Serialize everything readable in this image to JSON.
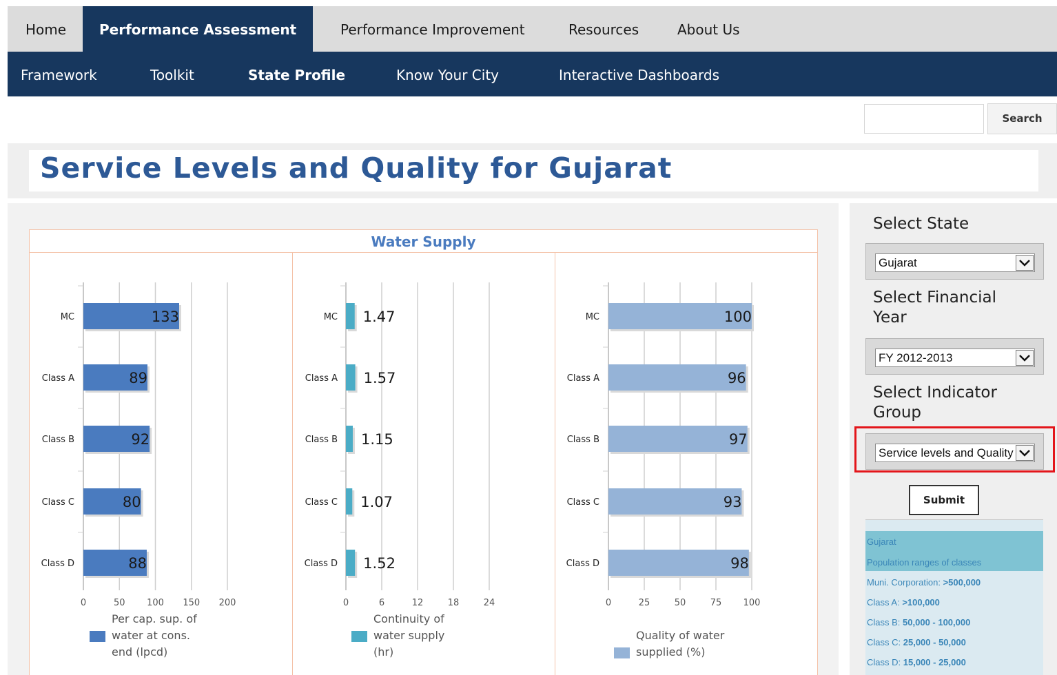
{
  "nav": {
    "primary": [
      {
        "label": "Home",
        "active": false
      },
      {
        "label": "Performance Assessment",
        "active": true
      },
      {
        "label": "Performance Improvement",
        "active": false
      },
      {
        "label": "Resources",
        "active": false
      },
      {
        "label": "About Us",
        "active": false
      }
    ],
    "secondary": [
      {
        "label": "Framework",
        "active": false
      },
      {
        "label": "Toolkit",
        "active": false
      },
      {
        "label": "State Profile",
        "active": true
      },
      {
        "label": "Know Your City",
        "active": false
      },
      {
        "label": "Interactive Dashboards",
        "active": false
      }
    ]
  },
  "search": {
    "value": "",
    "button_label": "Search"
  },
  "page": {
    "title": "Service Levels and Quality for Gujarat"
  },
  "chart_section": {
    "title": "Water Supply"
  },
  "chart_data": [
    {
      "type": "bar",
      "orientation": "horizontal",
      "categories": [
        "MC",
        "Class A",
        "Class B",
        "Class C",
        "Class D"
      ],
      "values": [
        133,
        89,
        92,
        80,
        88
      ],
      "value_labels": [
        "133",
        "89",
        "92",
        "80",
        "88"
      ],
      "xlim": [
        0,
        200
      ],
      "xticks": [
        0,
        50,
        100,
        150,
        200
      ],
      "grid": true,
      "legend": {
        "label": "Per cap. sup. of water at cons. end (lpcd)",
        "lines": [
          "Per cap. sup. of",
          "water at cons.",
          "end (lpcd)"
        ],
        "placement": "bottom"
      },
      "color": "#4a7bbf"
    },
    {
      "type": "bar",
      "orientation": "horizontal",
      "categories": [
        "MC",
        "Class A",
        "Class B",
        "Class C",
        "Class D"
      ],
      "values": [
        1.47,
        1.57,
        1.15,
        1.07,
        1.52
      ],
      "value_labels": [
        "1.47",
        "1.57",
        "1.15",
        "1.07",
        "1.52"
      ],
      "xlim": [
        0,
        24
      ],
      "xticks": [
        0,
        6,
        12,
        18,
        24
      ],
      "grid": true,
      "legend": {
        "label": "Continuity of water supply (hr)",
        "lines": [
          "Continuity of",
          "water supply",
          "(hr)"
        ],
        "placement": "bottom"
      },
      "color": "#4bacc6"
    },
    {
      "type": "bar",
      "orientation": "horizontal",
      "categories": [
        "MC",
        "Class A",
        "Class B",
        "Class C",
        "Class D"
      ],
      "values": [
        100,
        96,
        97,
        93,
        98
      ],
      "value_labels": [
        "100",
        "96",
        "97",
        "93",
        "98"
      ],
      "xlim": [
        0,
        100
      ],
      "xticks": [
        0,
        25,
        50,
        75,
        100
      ],
      "grid": true,
      "legend": {
        "label": "Quality of water supplied (%)",
        "lines": [
          "Quality of water",
          "supplied (%)"
        ],
        "placement": "bottom"
      },
      "color": "#95b3d7"
    }
  ],
  "sidebar": {
    "state_label": "Select State",
    "state_value": "Gujarat",
    "year_label_lines": [
      "Select Financial",
      "Year"
    ],
    "year_value": "FY 2012-2013",
    "group_label_lines": [
      "Select Indicator",
      "Group"
    ],
    "group_value": "Service levels and Quality",
    "submit_label": "Submit",
    "info": {
      "state": "Gujarat",
      "heading": "Population ranges of classes",
      "rows": [
        {
          "label": "Muni. Corporation:",
          "range": ">500,000"
        },
        {
          "label": "Class A:",
          "range": ">100,000"
        },
        {
          "label": "Class B:",
          "range": "50,000 - 100,000"
        },
        {
          "label": "Class C:",
          "range": "25,000 - 50,000"
        },
        {
          "label": "Class D:",
          "range": "15,000 - 25,000"
        }
      ]
    }
  }
}
